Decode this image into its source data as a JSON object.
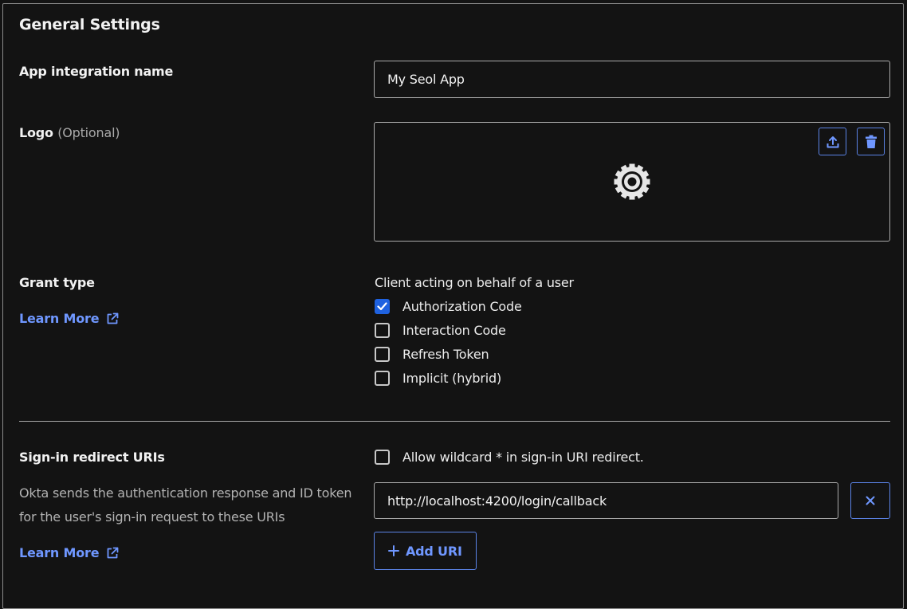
{
  "section_title": "General Settings",
  "app_name": {
    "label": "App integration name",
    "value": "My Seol App"
  },
  "logo": {
    "label": "Logo",
    "optional": "(Optional)"
  },
  "grant_type": {
    "label": "Grant type",
    "learn_more": "Learn More",
    "subheading": "Client acting on behalf of a user",
    "options": [
      {
        "label": "Authorization Code",
        "checked": true
      },
      {
        "label": "Interaction Code",
        "checked": false
      },
      {
        "label": "Refresh Token",
        "checked": false
      },
      {
        "label": "Implicit (hybrid)",
        "checked": false
      }
    ]
  },
  "redirect": {
    "label": "Sign-in redirect URIs",
    "description": "Okta sends the authentication response and ID token for the user's sign-in request to these URIs",
    "learn_more": "Learn More",
    "wildcard_label": "Allow wildcard * in sign-in URI redirect.",
    "wildcard_checked": false,
    "uri_value": "http://localhost:4200/login/callback",
    "add_uri": "Add URI"
  },
  "colors": {
    "background": "#131313",
    "accent": "#6f97ff",
    "checkbox_checked": "#1f62e0"
  }
}
